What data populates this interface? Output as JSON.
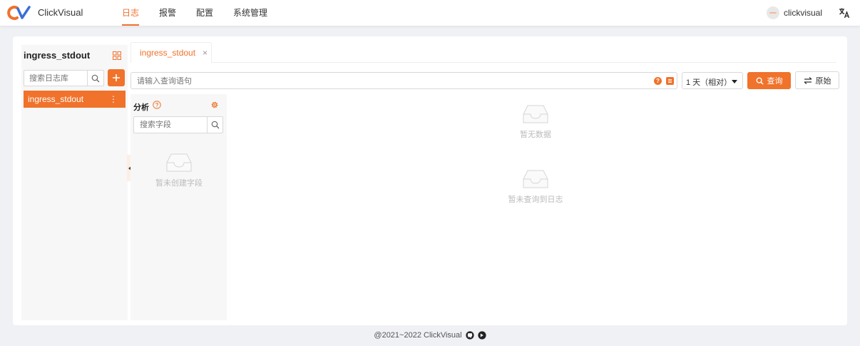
{
  "header": {
    "brand": "ClickVisual",
    "nav": [
      {
        "label": "日志",
        "active": true
      },
      {
        "label": "报警",
        "active": false
      },
      {
        "label": "配置",
        "active": false
      },
      {
        "label": "系统管理",
        "active": false
      }
    ],
    "user_name": "clickvisual",
    "accent_color": "#f0722b",
    "lang_icon": "translate-icon"
  },
  "sidebar": {
    "title": "ingress_stdout",
    "search_placeholder": "搜索日志库",
    "items": [
      {
        "label": "ingress_stdout",
        "menu_glyph": "⋮",
        "active": true
      }
    ]
  },
  "tabs": [
    {
      "label": "ingress_stdout",
      "close_glyph": "×"
    }
  ],
  "query": {
    "placeholder": "请输入查询语句",
    "help_glyph": "?",
    "time_range": "1 天（相对）",
    "query_button": "查询",
    "raw_button": "原始"
  },
  "fields": {
    "title": "分析",
    "search_placeholder": "搜索字段",
    "empty_text": "暂未创建字段"
  },
  "results": {
    "no_data_text": "暂无数据",
    "no_logs_text": "暂未查询到日志"
  },
  "footer": {
    "copyright": "@2021~2022 ClickVisual"
  }
}
